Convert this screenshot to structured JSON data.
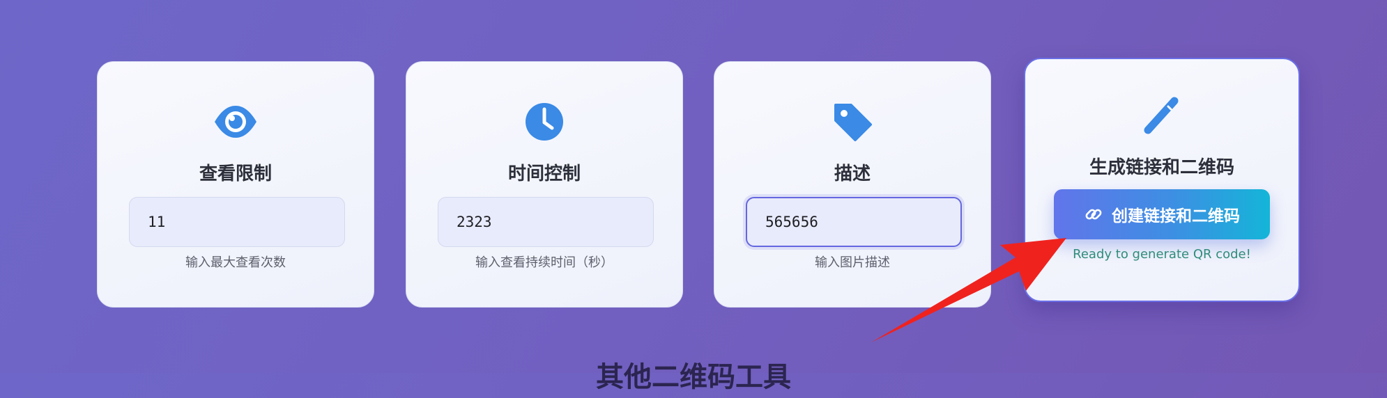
{
  "cards": [
    {
      "icon": "eye-icon",
      "title": "查看限制",
      "input_value": "11",
      "hint": "输入最大查看次数"
    },
    {
      "icon": "clock-icon",
      "title": "时间控制",
      "input_value": "2323",
      "hint": "输入查看持续时间（秒）"
    },
    {
      "icon": "tag-icon",
      "title": "描述",
      "input_value": "565656",
      "hint": "输入图片描述"
    }
  ],
  "generate": {
    "icon": "pencil-icon",
    "title": "生成链接和二维码",
    "button_label": "创建链接和二维码",
    "button_icon": "link-icon",
    "status": "Ready to generate QR code!"
  },
  "bottom_title": "其他二维码工具",
  "colors": {
    "accent_icon": "#3a8ae6",
    "status_text": "#2f8c7a",
    "arrow": "#f0221e"
  }
}
